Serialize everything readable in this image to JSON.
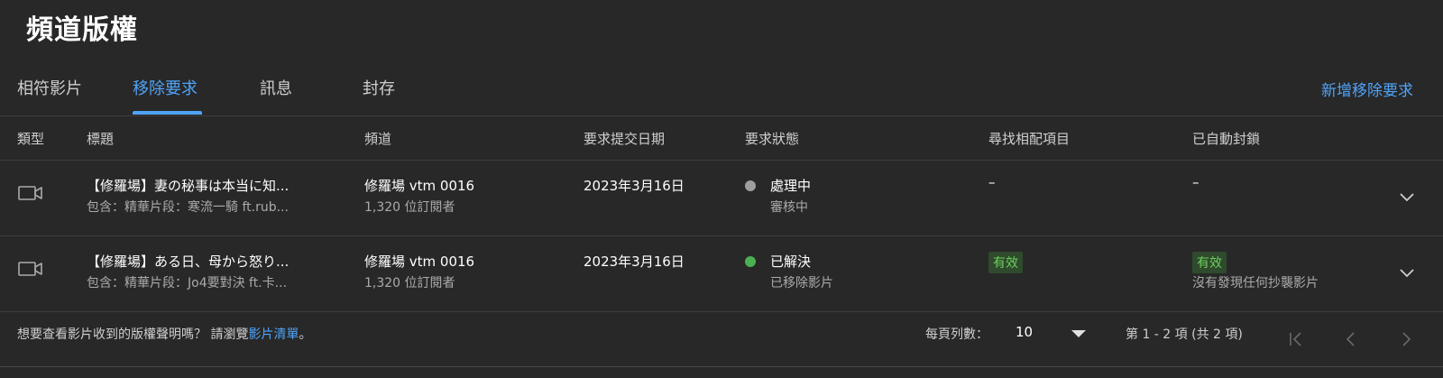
{
  "page": {
    "title": "頻道版權"
  },
  "tabs": [
    {
      "label": "相符影片"
    },
    {
      "label": "移除要求"
    },
    {
      "label": "訊息"
    },
    {
      "label": "封存"
    }
  ],
  "active_tab": "移除要求",
  "actions": {
    "add_request": "新增移除要求"
  },
  "table": {
    "headers": {
      "type": "類型",
      "title": "標題",
      "channel": "頻道",
      "date": "要求提交日期",
      "status": "要求狀態",
      "match": "尋找相配項目",
      "autoblock": "已自動封鎖"
    },
    "rows": [
      {
        "type_icon": "video-icon",
        "title": "【修羅場】妻の秘事は本当に知...",
        "subtitle": "包含：精華片段：寒流一騎 ft.rub...",
        "channel": "修羅場 vtm 0016",
        "subscribers": "1,320 位訂閱者",
        "date": "2023年3月16日",
        "status": "處理中",
        "status_detail": "審核中",
        "status_color": "#9e9e9e",
        "match": "–",
        "autoblock": "–",
        "autoblock_detail": ""
      },
      {
        "type_icon": "video-icon",
        "title": "【修羅場】ある日、母から怒り...",
        "subtitle": "包含：精華片段：Jo4要對決 ft.卡...",
        "channel": "修羅場 vtm 0016",
        "subscribers": "1,320 位訂閱者",
        "date": "2023年3月16日",
        "status": "已解決",
        "status_detail": "已移除影片",
        "status_color": "#4caf50",
        "match": "有效",
        "autoblock": "有效",
        "autoblock_detail": "沒有發現任何抄襲影片"
      }
    ]
  },
  "footer": {
    "text_prefix": "想要查看影片收到的版權聲明嗎？ 請瀏覽",
    "link": "影片清單",
    "text_suffix": "。",
    "rows_per_page_label": "每頁列數：",
    "rows_per_page": "10",
    "range": "第 1 - 2 項 (共 2 項)"
  },
  "colors": {
    "accent": "#4fa3f7",
    "background": "#282828",
    "valid": "#6ccf5f"
  }
}
